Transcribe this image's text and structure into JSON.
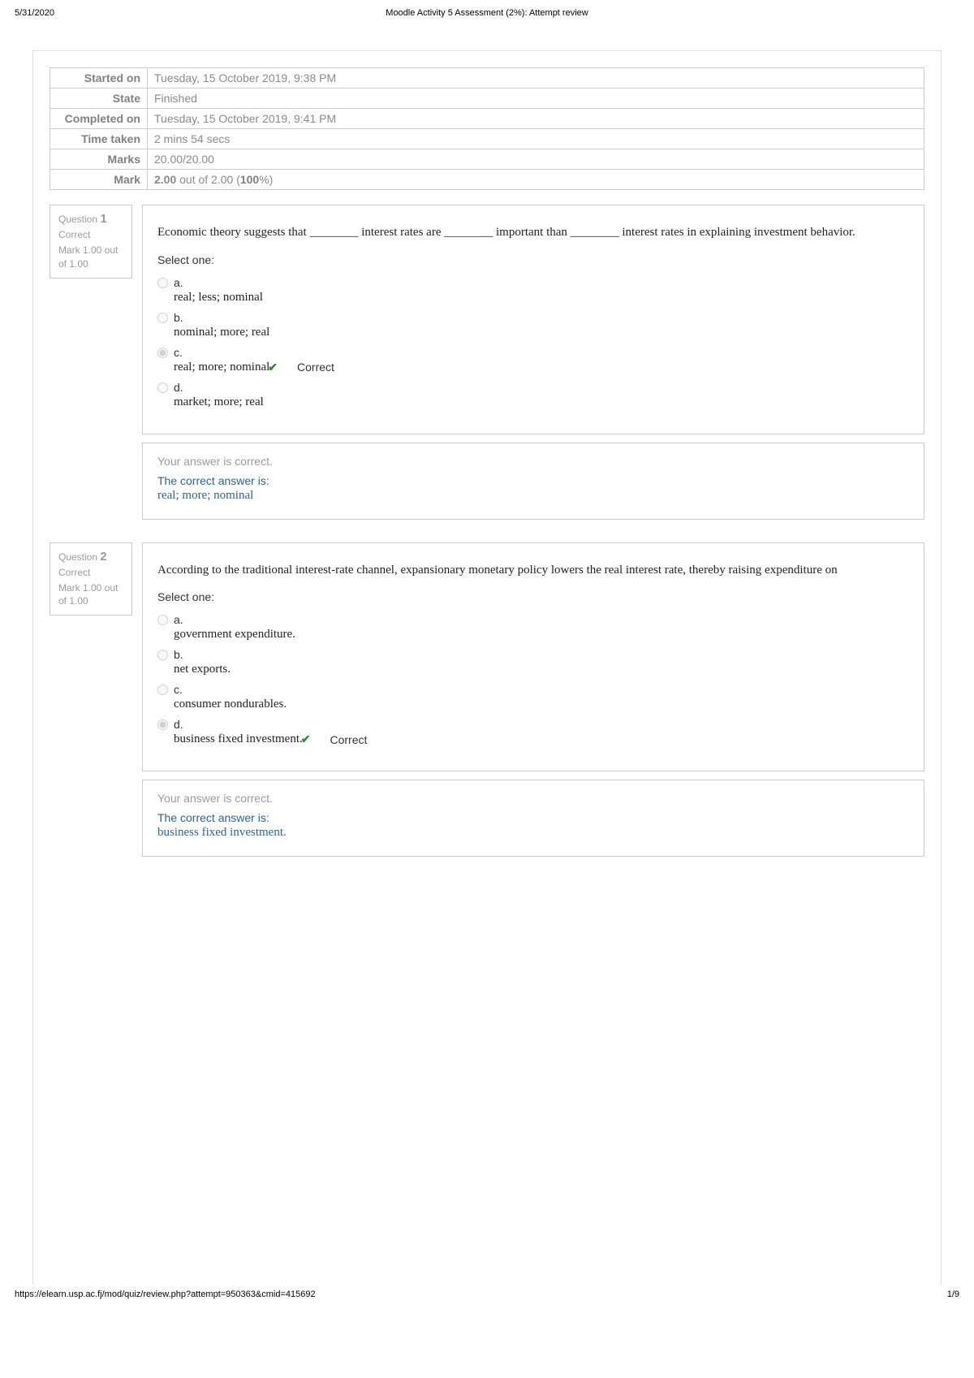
{
  "header": {
    "date": "5/31/2020",
    "title": "Moodle Activity 5 Assessment (2%): Attempt review"
  },
  "summary": {
    "rows": [
      {
        "label": "Started on",
        "value": "Tuesday, 15 October 2019, 9:38 PM"
      },
      {
        "label": "State",
        "value": "Finished"
      },
      {
        "label": "Completed on",
        "value": "Tuesday, 15 October 2019, 9:41 PM"
      },
      {
        "label": "Time taken",
        "value": "2 mins 54 secs"
      },
      {
        "label": "Marks",
        "value": "20.00/20.00"
      }
    ],
    "mark_label": "Mark",
    "mark_value_pre": "2.00",
    "mark_value_mid": " out of 2.00 (",
    "mark_value_pct": "100",
    "mark_value_post": "%)"
  },
  "labels": {
    "question_word": "Question",
    "select_one": "Select one:",
    "your_answer_correct": "Your answer is correct.",
    "correct_answer_is": "The correct answer is:",
    "correct_tag": "Correct"
  },
  "questions": [
    {
      "number": "1",
      "status": "Correct",
      "mark": "Mark 1.00 out of 1.00",
      "text": "Economic theory suggests that ________ interest rates are ________ important than ________ interest rates in explaining investment behavior.",
      "options": [
        {
          "letter": "a.",
          "text": "real; less; nominal",
          "selected": false,
          "correct": false
        },
        {
          "letter": "b.",
          "text": "nominal; more; real",
          "selected": false,
          "correct": false
        },
        {
          "letter": "c.",
          "text": "real; more; nominal",
          "selected": true,
          "correct": true
        },
        {
          "letter": "d.",
          "text": "market; more; real",
          "selected": false,
          "correct": false
        }
      ],
      "correct_answer": "real; more; nominal"
    },
    {
      "number": "2",
      "status": "Correct",
      "mark": "Mark 1.00 out of 1.00",
      "text": "According to the traditional interest-rate channel, expansionary monetary policy lowers the real interest rate, thereby raising expenditure on",
      "options": [
        {
          "letter": "a.",
          "text": "government expenditure.",
          "selected": false,
          "correct": false
        },
        {
          "letter": "b.",
          "text": "net exports.",
          "selected": false,
          "correct": false
        },
        {
          "letter": "c.",
          "text": "consumer nondurables.",
          "selected": false,
          "correct": false
        },
        {
          "letter": "d.",
          "text": "business fixed investment.",
          "selected": true,
          "correct": true
        }
      ],
      "correct_answer": "business fixed investment."
    }
  ],
  "footer": {
    "url": "https://elearn.usp.ac.fj/mod/quiz/review.php?attempt=950363&cmid=415692",
    "page": "1/9"
  }
}
